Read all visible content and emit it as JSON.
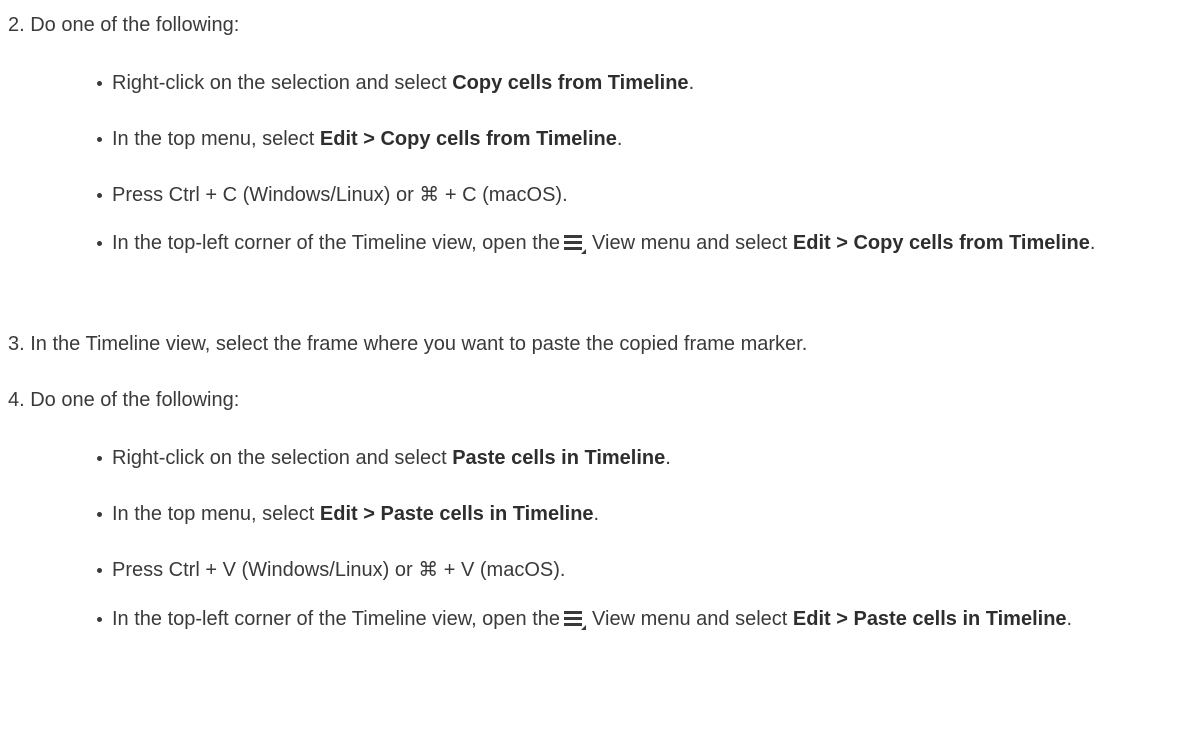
{
  "steps": [
    {
      "label": "2.  Do one of the following:",
      "bullets": [
        {
          "pre": "Right-click on the selection and select ",
          "bold": "Copy cells from Timeline",
          "post": "."
        },
        {
          "pre": "In the top menu, select ",
          "bold": "Edit > Copy cells from Timeline",
          "post": "."
        },
        {
          "text": "Press Ctrl + C (Windows/Linux) or ⌘ + C (macOS)."
        },
        {
          "pre": "In the top-left corner of the Timeline view, open the",
          "mid": "View menu and select ",
          "bold": "Edit > Copy cells from Timeline",
          "post": "."
        }
      ]
    },
    {
      "label": "3.  In the Timeline view, select the frame where you want to paste the copied frame marker."
    },
    {
      "label": "4.  Do one of the following:",
      "bullets": [
        {
          "pre": "Right-click on the selection and select ",
          "bold": "Paste cells in Timeline",
          "post": "."
        },
        {
          "pre": "In the top menu, select ",
          "bold": "Edit > Paste cells in Timeline",
          "post": "."
        },
        {
          "text": "Press Ctrl + V (Windows/Linux) or ⌘ + V (macOS)."
        },
        {
          "pre": "In the top-left corner of the Timeline view, open the",
          "mid": "View menu and select ",
          "bold": "Edit > Paste cells in Timeline",
          "post": "."
        }
      ]
    }
  ],
  "icons": {
    "view_menu": "hamburger-menu-icon"
  }
}
